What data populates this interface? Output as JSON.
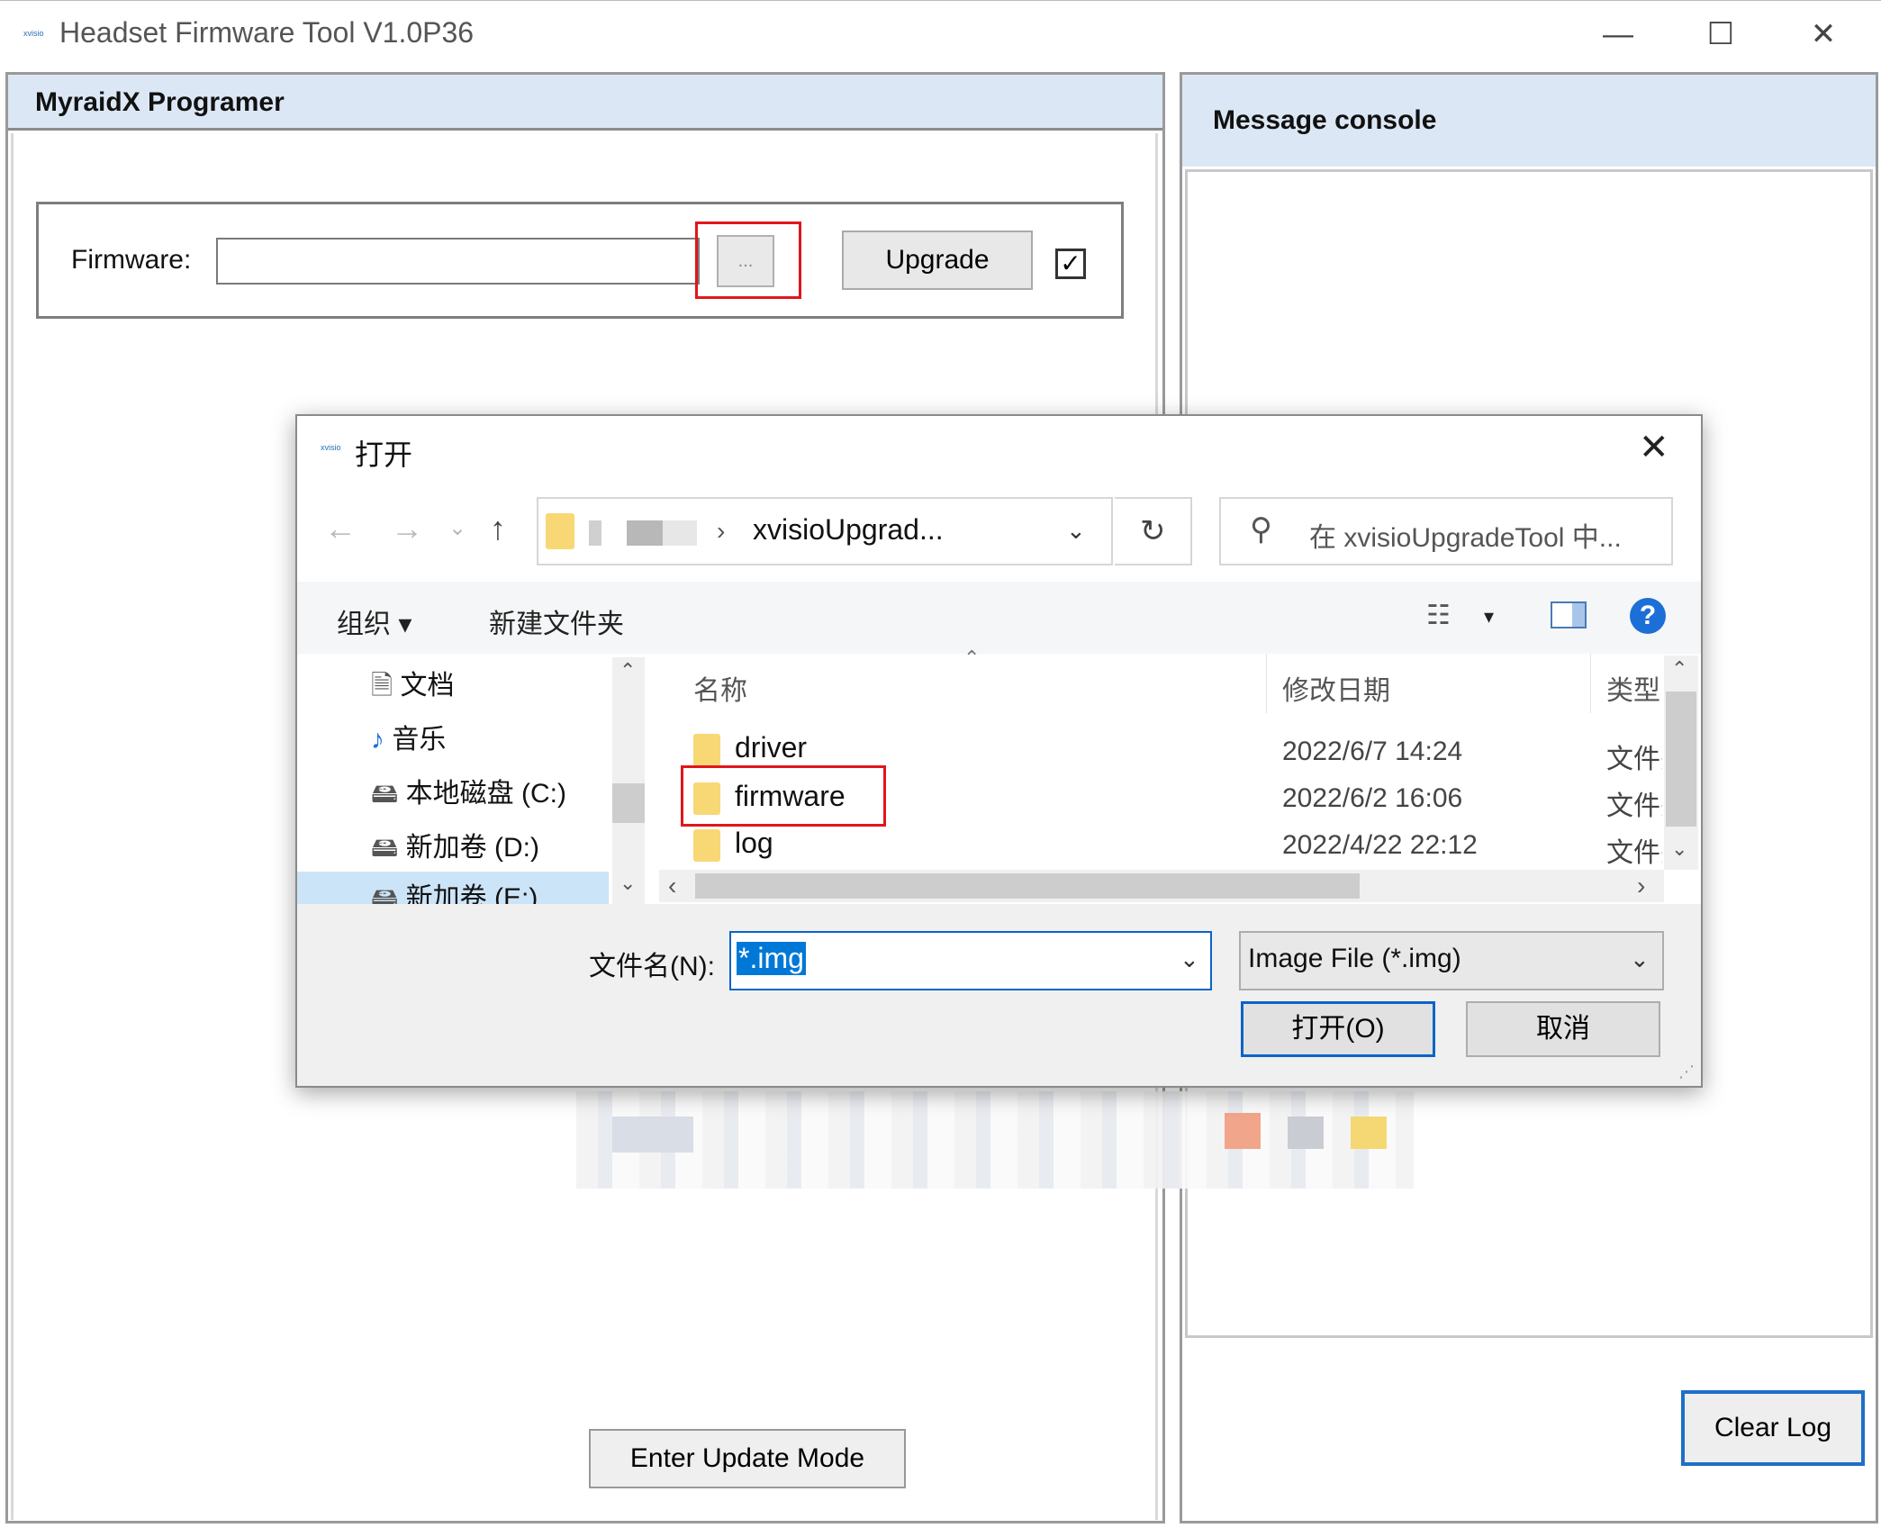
{
  "window": {
    "title": "Headset Firmware Tool V1.0P36",
    "icon_label": "xvisio",
    "minimize": "—",
    "maximize": "☐",
    "close": "✕"
  },
  "left_panel": {
    "title": "MyraidX Programer",
    "firmware_label": "Firmware:",
    "firmware_value": "",
    "browse_label": "...",
    "upgrade_label": "Upgrade",
    "check_mark": "✓",
    "enter_update_label": "Enter Update Mode"
  },
  "right_panel": {
    "title": "Message console",
    "clear_log_label": "Clear Log"
  },
  "dialog": {
    "icon_label": "xvisio",
    "title": "打开",
    "close": "✕",
    "nav": {
      "back": "←",
      "forward": "→",
      "recent": "⌄",
      "up": "↑"
    },
    "address": {
      "separator": "›",
      "current": "xvisioUpgrad...",
      "chevron": "⌄",
      "refresh": "↻"
    },
    "search": {
      "icon": "⚲",
      "placeholder": "在 xvisioUpgradeTool 中..."
    },
    "toolbar": {
      "organize": "组织 ▾",
      "new_folder": "新建文件夹",
      "view_icon": "☷",
      "view_arrow": "▾",
      "help": "?"
    },
    "tree": [
      {
        "label": "文档",
        "icon": "document-icon",
        "glyph": "🗎"
      },
      {
        "label": "音乐",
        "icon": "music-icon",
        "glyph": "♪"
      },
      {
        "label": "本地磁盘 (C:)",
        "icon": "drive-icon",
        "glyph": "🖴"
      },
      {
        "label": "新加卷 (D:)",
        "icon": "drive-icon",
        "glyph": "🖴"
      },
      {
        "label": "新加卷 (E:)",
        "icon": "drive-icon",
        "glyph": "🖴"
      }
    ],
    "columns": {
      "name": "名称",
      "date": "修改日期",
      "type": "类型"
    },
    "files": [
      {
        "name": "driver",
        "date": "2022/6/7 14:24",
        "type": "文件夹"
      },
      {
        "name": "firmware",
        "date": "2022/6/2 16:06",
        "type": "文件夹"
      },
      {
        "name": "log",
        "date": "2022/4/22 22:12",
        "type": "文件夹"
      }
    ],
    "filename_label": "文件名(N):",
    "filename_value": "*.img",
    "filetype_value": "Image File (*.img)",
    "open_label": "打开(O)",
    "cancel_label": "取消",
    "scroll": {
      "up": "⌃",
      "down": "⌄",
      "left": "‹",
      "right": "›",
      "sort": "⌃"
    }
  },
  "colors": {
    "panel_header": "#dce7f5",
    "highlight_red": "#e0161b",
    "accent_blue": "#0078d7"
  }
}
